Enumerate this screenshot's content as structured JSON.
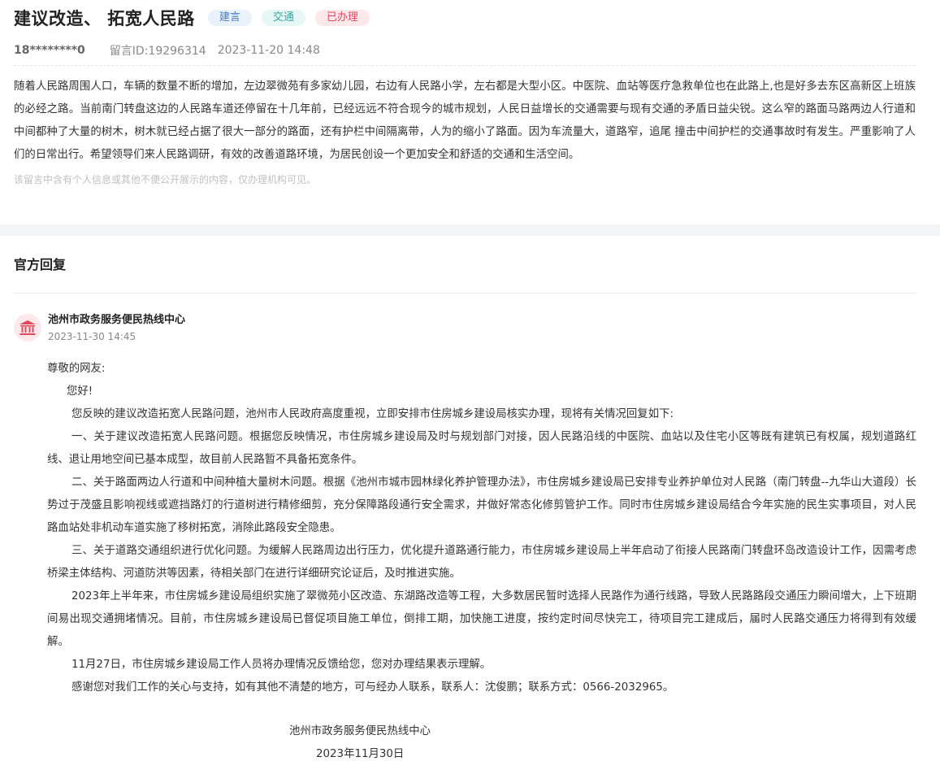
{
  "message": {
    "title": "建议改造、 拓宽人民路",
    "tags": [
      "建言",
      "交通",
      "已办理"
    ],
    "user": "18********0",
    "id_label": "留言ID:19296314",
    "datetime": "2023-11-20 14:48",
    "content": "随着人民路周围人口，车辆的数量不断的增加，左边翠微苑有多家幼儿园，右边有人民路小学，左右都是大型小区。中医院、血站等医疗急救单位也在此路上,也是好多去东区高新区上班族的必经之路。当前南门转盘这边的人民路车道还停留在十几年前，已经远远不符合现今的城市规划，人民日益增长的交通需要与现有交通的矛盾日益尖锐。这么窄的路面马路两边人行道和中间都种了大量的树木，树木就已经占据了很大一部分的路面，还有护栏中间隔离带，人为的缩小了路面。因为车流量大，道路窄，追尾 撞击中间护栏的交通事故时有发生。严重影响了人们的日常出行。希望领导们来人民路调研，有效的改善道路环境，为居民创设一个更加安全和舒适的交通和生活空间。",
    "privacy_notice": "该留言中含有个人信息或其他不便公开展示的内容，仅办理机构可见。"
  },
  "reply": {
    "section_title": "官方回复",
    "org_name": "池州市政务服务便民热线中心",
    "org_time": "2023-11-30 14:45",
    "greeting": "尊敬的网友:",
    "hello": "您好!",
    "paragraphs": [
      "您反映的建议改造拓宽人民路问题，池州市人民政府高度重视，立即安排市住房城乡建设局核实办理，现将有关情况回复如下:",
      " 一、关于建议改造拓宽人民路问题。根据您反映情况，市住房城乡建设局及时与规划部门对接，因人民路沿线的中医院、血站以及住宅小区等既有建筑已有权属，规划道路红线、退让用地空间已基本成型，故目前人民路暂不具备拓宽条件。",
      "二、关于路面两边人行道和中间种植大量树木问题。根据《池州市城市园林绿化养护管理办法》，市住房城乡建设局已安排专业养护单位对人民路（南门转盘--九华山大道段）长势过于茂盛且影响视线或遮挡路灯的行道树进行精修细剪，充分保障路段通行安全需求，并做好常态化修剪管护工作。同时市住房城乡建设局结合今年实施的民生实事项目，对人民路血站处非机动车道实施了移树拓宽，消除此路段安全隐患。",
      "三、关于道路交通组织进行优化问题。为缓解人民路周边出行压力，优化提升道路通行能力，市住房城乡建设局上半年启动了衔接人民路南门转盘环岛改造设计工作，因需考虑桥梁主体结构、河道防洪等因素，待相关部门在进行详细研究论证后，及时推进实施。",
      "2023年上半年来，市住房城乡建设局组织实施了翠微苑小区改造、东湖路改造等工程，大多数居民暂时选择人民路作为通行线路，导致人民路路段交通压力瞬间增大，上下班期间易出现交通拥堵情况。目前，市住房城乡建设局已督促项目施工单位，倒排工期，加快施工进度，按约定时间尽快完工，待项目完工建成后，届时人民路交通压力将得到有效缓解。",
      "11月27日，市住房城乡建设局工作人员将办理情况反馈给您，您对办理结果表示理解。",
      "感谢您对我们工作的关心与支持，如有其他不清楚的地方，可与经办人联系，联系人：沈俊鹏；联系方式：0566-2032965。"
    ],
    "signature_org": "池州市政务服务便民热线中心",
    "signature_date": "2023年11月30日"
  }
}
